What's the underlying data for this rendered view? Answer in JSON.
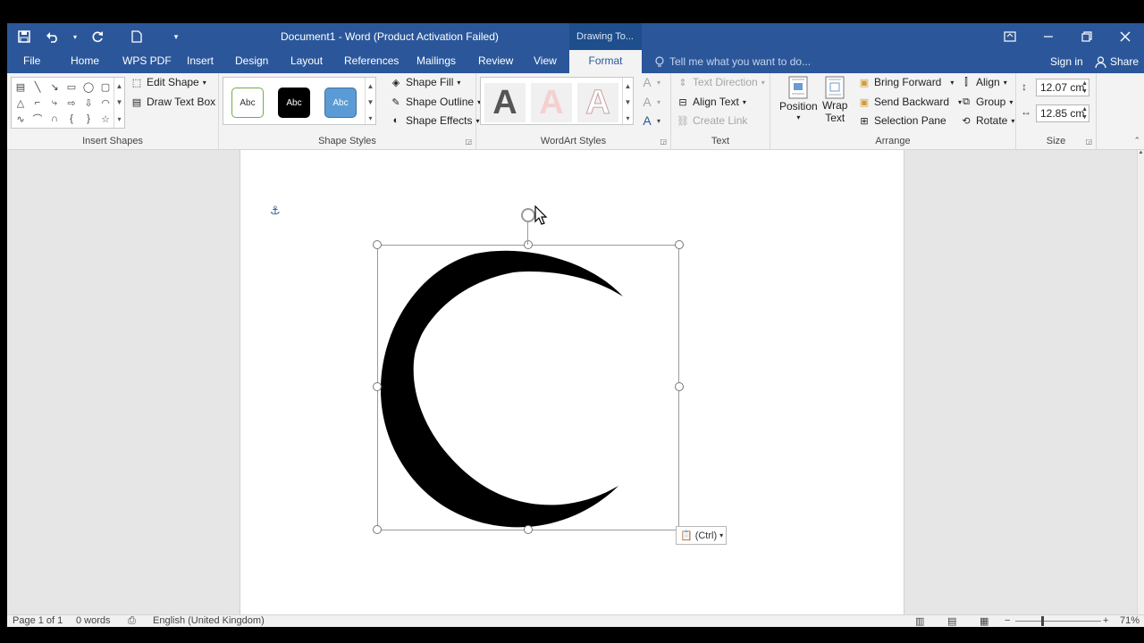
{
  "window": {
    "title": "Document1 - Word (Product Activation Failed)",
    "context_tab_header": "Drawing To...",
    "accent_color": "#2b579a"
  },
  "qat": {
    "save_icon": "save-icon",
    "undo_icon": "undo-icon",
    "redo_icon": "redo-icon",
    "new_icon": "new-document-icon",
    "customize_icon": "customize-icon"
  },
  "tabs": [
    "File",
    "Home",
    "WPS PDF",
    "Insert",
    "Design",
    "Layout",
    "References",
    "Mailings",
    "Review",
    "View",
    "Format"
  ],
  "active_tab": "Format",
  "tellme": {
    "placeholder": "Tell me what you want to do..."
  },
  "account": {
    "signin": "Sign in",
    "share": "Share"
  },
  "ribbon": {
    "insert_shapes": {
      "label": "Insert Shapes",
      "edit_shape": "Edit Shape",
      "draw_text_box": "Draw Text Box"
    },
    "shape_styles": {
      "label": "Shape Styles",
      "swatch_text": "Abc",
      "shape_fill": "Shape Fill",
      "shape_outline": "Shape Outline",
      "shape_effects": "Shape Effects"
    },
    "wordart_styles": {
      "label": "WordArt Styles",
      "letter": "A"
    },
    "text": {
      "label": "Text",
      "text_direction": "Text Direction",
      "align_text": "Align Text",
      "create_link": "Create Link"
    },
    "arrange": {
      "label": "Arrange",
      "position": "Position",
      "wrap_text_1": "Wrap",
      "wrap_text_2": "Text",
      "bring_forward": "Bring Forward",
      "send_backward": "Send Backward",
      "selection_pane": "Selection Pane",
      "align": "Align",
      "group": "Group",
      "rotate": "Rotate"
    },
    "size": {
      "label": "Size",
      "height": "12.07 cm",
      "width": "12.85 cm"
    }
  },
  "document": {
    "paste_options": "(Ctrl)"
  },
  "status": {
    "page": "Page 1 of 1",
    "words": "0 words",
    "language": "English (United Kingdom)",
    "zoom": "71%"
  }
}
